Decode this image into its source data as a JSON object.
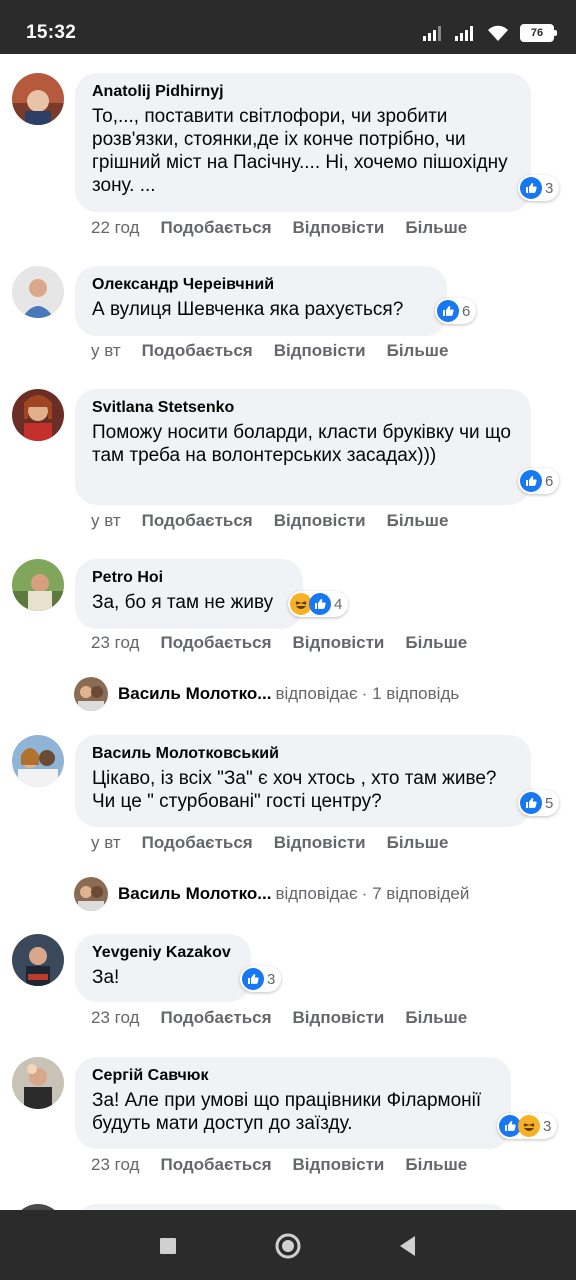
{
  "status_bar": {
    "time": "15:32",
    "battery": "76"
  },
  "actions": {
    "like": "Подобається",
    "reply": "Відповісти",
    "more": "Більше"
  },
  "comments": [
    {
      "author": "Anatolij Pidhirnyj",
      "text": "То,..., поставити світлофори, чи зробити розв'язки, стоянки,де іх конче потрібно, чи грішний міст на Пасічну.... Ні, хочемо пішохідну зону. ...",
      "time": "22 год",
      "reactions": {
        "types": [
          "like"
        ],
        "count": "3"
      }
    },
    {
      "author": "Олександр Череівчний",
      "text": "А вулиця Шевченка яка рахується?",
      "time": "у вт",
      "reactions": {
        "types": [
          "like"
        ],
        "count": "6"
      }
    },
    {
      "author": "Svitlana Stetsenko",
      "text": "Поможу носити боларди, класти бруківку чи що там треба на волонтерських засадах)))",
      "time": "у вт",
      "reactions": {
        "types": [
          "like"
        ],
        "count": "6"
      }
    },
    {
      "author": "Petro Hoi",
      "text": "За, бо я там не живу",
      "time": "23 год",
      "reactions": {
        "types": [
          "haha",
          "like"
        ],
        "count": "4"
      }
    },
    {
      "author": "Василь Молотковський",
      "text": "Цікаво, із всіх \"За\" є хоч хтось , хто там живе? Чи це \" стурбовані\" гості центру?",
      "time": "у вт",
      "reactions": {
        "types": [
          "like"
        ],
        "count": "5"
      }
    },
    {
      "author": "Yevgeniy Kazakov",
      "text": "За!",
      "time": "23 год",
      "reactions": {
        "types": [
          "like"
        ],
        "count": "3"
      }
    },
    {
      "author": "Сергій Савчюк",
      "text": "За! Але при умові що працівники Філармонії будуть мати доступ до заїзду.",
      "time": "23 год",
      "reactions": {
        "types": [
          "like",
          "haha"
        ],
        "count": "3"
      }
    }
  ],
  "replies": [
    {
      "name": "Василь Молотко...",
      "verb": "відповідає",
      "count": "· 1 відповідь"
    },
    {
      "name": "Василь Молотко...",
      "verb": "відповідає",
      "count": "· 7 відповідей"
    }
  ]
}
